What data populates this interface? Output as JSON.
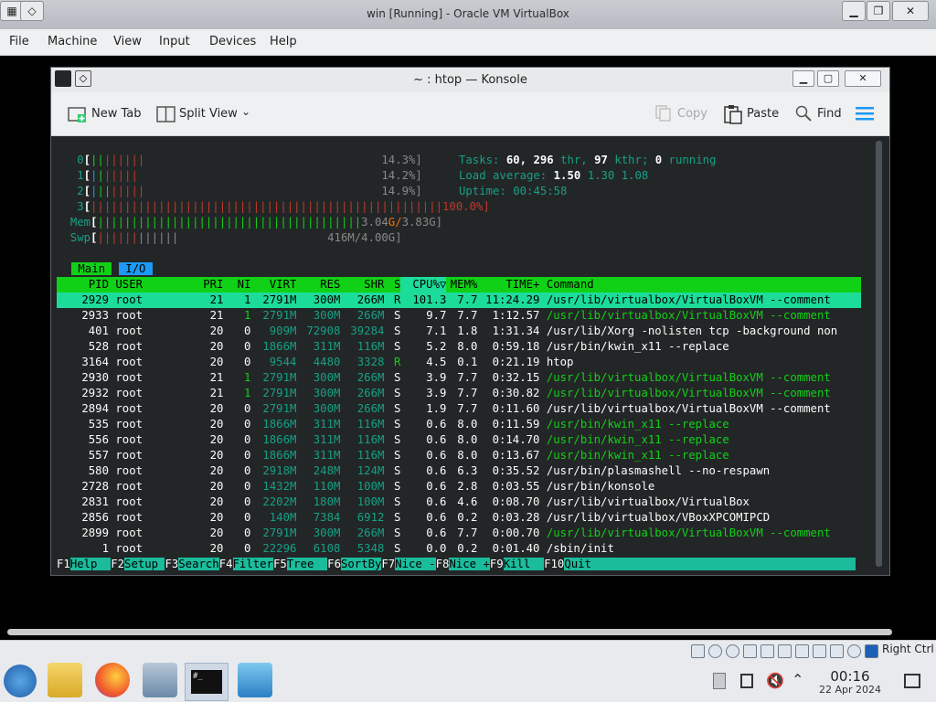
{
  "vbox": {
    "title": "win [Running] - Oracle VM VirtualBox",
    "menu": [
      "File",
      "Machine",
      "View",
      "Input",
      "Devices",
      "Help"
    ]
  },
  "konsole": {
    "title": "~ : htop — Konsole",
    "toolbar": {
      "new_tab": "New Tab",
      "split_view": "Split View",
      "copy": "Copy",
      "paste": "Paste",
      "find": "Find"
    }
  },
  "htop": {
    "cpu_meters": [
      {
        "id": "0",
        "value": "14.3%]"
      },
      {
        "id": "1",
        "value": "14.2%]"
      },
      {
        "id": "2",
        "value": "14.9%]"
      },
      {
        "id": "3",
        "value": "100.0%]"
      }
    ],
    "mem": {
      "label": "Mem",
      "used": "3.04",
      "sep": "G/",
      "total": "3.83G]"
    },
    "swp": {
      "label": "Swp",
      "value": "416M/4.00G]"
    },
    "tasks": {
      "label": "Tasks:",
      "count": "60,",
      "thr": "296",
      "thr_label": "thr,",
      "kthr": "97",
      "kthr_label": "kthr;",
      "running": "0",
      "running_label": "running"
    },
    "load": {
      "label": "Load average:",
      "l1": "1.50",
      "l5": "1.30",
      "l15": "1.08"
    },
    "uptime": {
      "label": "Uptime:",
      "value": "00:45:58"
    },
    "tabs": [
      "Main",
      "I/O"
    ],
    "columns": {
      "pid": "PID",
      "user": "USER",
      "pri": "PRI",
      "ni": "NI",
      "virt": "VIRT",
      "res": "RES",
      "shr": "SHR",
      "s": "S",
      "cpu": "CPU%▽",
      "mem": "MEM%",
      "time": "TIME+",
      "command": "Command"
    },
    "processes": [
      {
        "pid": "2929",
        "user": "root",
        "pri": "21",
        "ni": "1",
        "virt": "2791M",
        "res": "300M",
        "shr": "266M",
        "s": "R",
        "cpu": "101.3",
        "mem": "7.7",
        "time": "11:24.29",
        "command": "/usr/lib/virtualbox/VirtualBoxVM --comment"
      },
      {
        "pid": "2933",
        "user": "root",
        "pri": "21",
        "ni": "1",
        "virt": "2791M",
        "res": "300M",
        "shr": "266M",
        "s": "S",
        "cpu": "9.7",
        "mem": "7.7",
        "time": "1:12.57",
        "command": "/usr/lib/virtualbox/VirtualBoxVM --comment"
      },
      {
        "pid": "401",
        "user": "root",
        "pri": "20",
        "ni": "0",
        "virt": "909M",
        "res": "72908",
        "shr": "39284",
        "s": "S",
        "cpu": "7.1",
        "mem": "1.8",
        "time": "1:31.34",
        "command": "/usr/lib/Xorg -nolisten tcp -background non"
      },
      {
        "pid": "528",
        "user": "root",
        "pri": "20",
        "ni": "0",
        "virt": "1866M",
        "res": "311M",
        "shr": "116M",
        "s": "S",
        "cpu": "5.2",
        "mem": "8.0",
        "time": "0:59.18",
        "command": "/usr/bin/kwin_x11 --replace"
      },
      {
        "pid": "3164",
        "user": "root",
        "pri": "20",
        "ni": "0",
        "virt": "9544",
        "res": "4480",
        "shr": "3328",
        "s": "R",
        "cpu": "4.5",
        "mem": "0.1",
        "time": "0:21.19",
        "command": "htop"
      },
      {
        "pid": "2930",
        "user": "root",
        "pri": "21",
        "ni": "1",
        "virt": "2791M",
        "res": "300M",
        "shr": "266M",
        "s": "S",
        "cpu": "3.9",
        "mem": "7.7",
        "time": "0:32.15",
        "command": "/usr/lib/virtualbox/VirtualBoxVM --comment"
      },
      {
        "pid": "2932",
        "user": "root",
        "pri": "21",
        "ni": "1",
        "virt": "2791M",
        "res": "300M",
        "shr": "266M",
        "s": "S",
        "cpu": "3.9",
        "mem": "7.7",
        "time": "0:30.82",
        "command": "/usr/lib/virtualbox/VirtualBoxVM --comment"
      },
      {
        "pid": "2894",
        "user": "root",
        "pri": "20",
        "ni": "0",
        "virt": "2791M",
        "res": "300M",
        "shr": "266M",
        "s": "S",
        "cpu": "1.9",
        "mem": "7.7",
        "time": "0:11.60",
        "command": "/usr/lib/virtualbox/VirtualBoxVM --comment"
      },
      {
        "pid": "535",
        "user": "root",
        "pri": "20",
        "ni": "0",
        "virt": "1866M",
        "res": "311M",
        "shr": "116M",
        "s": "S",
        "cpu": "0.6",
        "mem": "8.0",
        "time": "0:11.59",
        "command": "/usr/bin/kwin_x11 --replace"
      },
      {
        "pid": "556",
        "user": "root",
        "pri": "20",
        "ni": "0",
        "virt": "1866M",
        "res": "311M",
        "shr": "116M",
        "s": "S",
        "cpu": "0.6",
        "mem": "8.0",
        "time": "0:14.70",
        "command": "/usr/bin/kwin_x11 --replace"
      },
      {
        "pid": "557",
        "user": "root",
        "pri": "20",
        "ni": "0",
        "virt": "1866M",
        "res": "311M",
        "shr": "116M",
        "s": "S",
        "cpu": "0.6",
        "mem": "8.0",
        "time": "0:13.67",
        "command": "/usr/bin/kwin_x11 --replace"
      },
      {
        "pid": "580",
        "user": "root",
        "pri": "20",
        "ni": "0",
        "virt": "2918M",
        "res": "248M",
        "shr": "124M",
        "s": "S",
        "cpu": "0.6",
        "mem": "6.3",
        "time": "0:35.52",
        "command": "/usr/bin/plasmashell --no-respawn"
      },
      {
        "pid": "2728",
        "user": "root",
        "pri": "20",
        "ni": "0",
        "virt": "1432M",
        "res": "110M",
        "shr": "100M",
        "s": "S",
        "cpu": "0.6",
        "mem": "2.8",
        "time": "0:03.55",
        "command": "/usr/bin/konsole"
      },
      {
        "pid": "2831",
        "user": "root",
        "pri": "20",
        "ni": "0",
        "virt": "2202M",
        "res": "180M",
        "shr": "100M",
        "s": "S",
        "cpu": "0.6",
        "mem": "4.6",
        "time": "0:08.70",
        "command": "/usr/lib/virtualbox/VirtualBox"
      },
      {
        "pid": "2856",
        "user": "root",
        "pri": "20",
        "ni": "0",
        "virt": "140M",
        "res": "7384",
        "shr": "6912",
        "s": "S",
        "cpu": "0.6",
        "mem": "0.2",
        "time": "0:03.28",
        "command": "/usr/lib/virtualbox/VBoxXPCOMIPCD"
      },
      {
        "pid": "2899",
        "user": "root",
        "pri": "20",
        "ni": "0",
        "virt": "2791M",
        "res": "300M",
        "shr": "266M",
        "s": "S",
        "cpu": "0.6",
        "mem": "7.7",
        "time": "0:00.70",
        "command": "/usr/lib/virtualbox/VirtualBoxVM --comment"
      },
      {
        "pid": "1",
        "user": "root",
        "pri": "20",
        "ni": "0",
        "virt": "22296",
        "res": "6108",
        "shr": "5348",
        "s": "S",
        "cpu": "0.0",
        "mem": "0.2",
        "time": "0:01.40",
        "command": "/sbin/init"
      }
    ],
    "fkeys": [
      {
        "key": "F1",
        "label": "Help  "
      },
      {
        "key": "F2",
        "label": "Setup "
      },
      {
        "key": "F3",
        "label": "Search"
      },
      {
        "key": "F4",
        "label": "Filter"
      },
      {
        "key": "F5",
        "label": "Tree  "
      },
      {
        "key": "F6",
        "label": "SortBy"
      },
      {
        "key": "F7",
        "label": "Nice -"
      },
      {
        "key": "F8",
        "label": "Nice +"
      },
      {
        "key": "F9",
        "label": "Kill  "
      },
      {
        "key": "F10",
        "label": "Quit                                       "
      }
    ]
  },
  "statusbar": {
    "host_key": "Right Ctrl"
  },
  "clock": {
    "time": "00:16",
    "date": "22 Apr 2024"
  },
  "colors": {
    "htop_green": "#11d116",
    "htop_cyan": "#1cdc9a",
    "htop_blue": "#1d99f3",
    "htop_red": "#c0392b"
  }
}
